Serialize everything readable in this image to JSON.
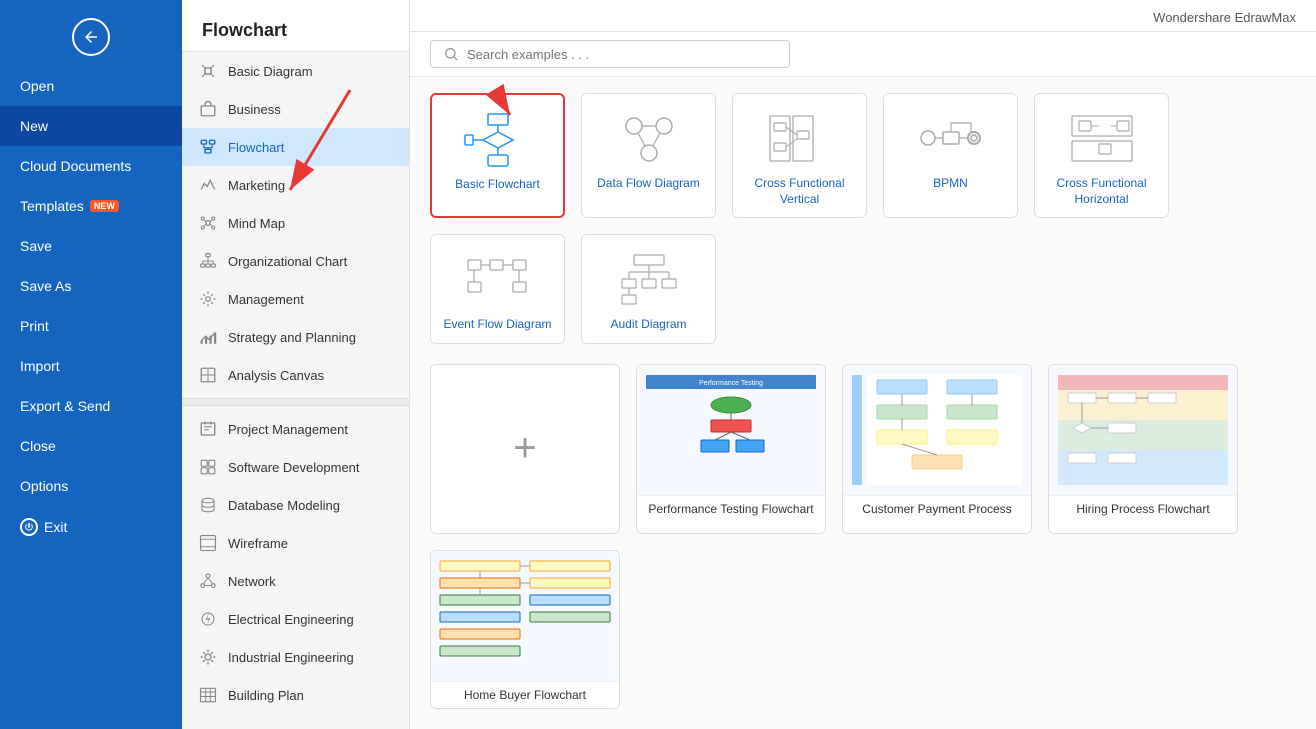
{
  "app": {
    "title": "Wondershare EdrawMax",
    "back_label": "←"
  },
  "sidebar": {
    "items": [
      {
        "id": "open",
        "label": "Open"
      },
      {
        "id": "new",
        "label": "New",
        "active": true
      },
      {
        "id": "cloud",
        "label": "Cloud Documents"
      },
      {
        "id": "templates",
        "label": "Templates",
        "badge": "NEW"
      },
      {
        "id": "save",
        "label": "Save"
      },
      {
        "id": "saveas",
        "label": "Save As"
      },
      {
        "id": "print",
        "label": "Print"
      },
      {
        "id": "import",
        "label": "Import"
      },
      {
        "id": "export",
        "label": "Export & Send"
      },
      {
        "id": "close",
        "label": "Close"
      },
      {
        "id": "options",
        "label": "Options"
      },
      {
        "id": "exit",
        "label": "Exit"
      }
    ]
  },
  "category_panel": {
    "header": "Flowchart",
    "items": [
      {
        "id": "basic",
        "label": "Basic Diagram",
        "icon": "diamond"
      },
      {
        "id": "business",
        "label": "Business",
        "icon": "briefcase"
      },
      {
        "id": "flowchart",
        "label": "Flowchart",
        "icon": "flow",
        "active": true
      },
      {
        "id": "marketing",
        "label": "Marketing",
        "icon": "bar"
      },
      {
        "id": "mindmap",
        "label": "Mind Map",
        "icon": "mindmap"
      },
      {
        "id": "orgchart",
        "label": "Organizational Chart",
        "icon": "org"
      },
      {
        "id": "management",
        "label": "Management",
        "icon": "gear"
      },
      {
        "id": "strategy",
        "label": "Strategy and Planning",
        "icon": "chart"
      },
      {
        "id": "analysis",
        "label": "Analysis Canvas",
        "icon": "canvas"
      },
      {
        "id": "project",
        "label": "Project Management",
        "icon": "proj"
      },
      {
        "id": "software",
        "label": "Software Development",
        "icon": "software"
      },
      {
        "id": "database",
        "label": "Database Modeling",
        "icon": "db"
      },
      {
        "id": "wireframe",
        "label": "Wireframe",
        "icon": "wireframe"
      },
      {
        "id": "network",
        "label": "Network",
        "icon": "network"
      },
      {
        "id": "electrical",
        "label": "Electrical Engineering",
        "icon": "electrical"
      },
      {
        "id": "industrial",
        "label": "Industrial Engineering",
        "icon": "industrial"
      },
      {
        "id": "building",
        "label": "Building Plan",
        "icon": "building"
      }
    ]
  },
  "search": {
    "placeholder": "Search examples . . ."
  },
  "templates": {
    "section_label": "",
    "items": [
      {
        "id": "basic-flowchart",
        "label": "Basic Flowchart",
        "selected": true
      },
      {
        "id": "data-flow",
        "label": "Data Flow Diagram",
        "selected": false
      },
      {
        "id": "cross-vertical",
        "label": "Cross Functional Vertical",
        "selected": false
      },
      {
        "id": "bpmn",
        "label": "BPMN",
        "selected": false
      },
      {
        "id": "cross-horizontal",
        "label": "Cross Functional Horizontal",
        "selected": false
      },
      {
        "id": "event-flow",
        "label": "Event Flow Diagram",
        "selected": false
      },
      {
        "id": "audit",
        "label": "Audit Diagram",
        "selected": false
      }
    ]
  },
  "examples": {
    "section_label": "",
    "items": [
      {
        "id": "new-file",
        "label": "",
        "type": "new"
      },
      {
        "id": "perf-testing",
        "label": "Performance Testing Flowchart",
        "type": "example"
      },
      {
        "id": "customer-payment",
        "label": "Customer Payment Process",
        "type": "example"
      },
      {
        "id": "hiring-process",
        "label": "Hiring Process Flowchart",
        "type": "example"
      },
      {
        "id": "home-buyer",
        "label": "Home Buyer Flowchart",
        "type": "example"
      }
    ]
  }
}
